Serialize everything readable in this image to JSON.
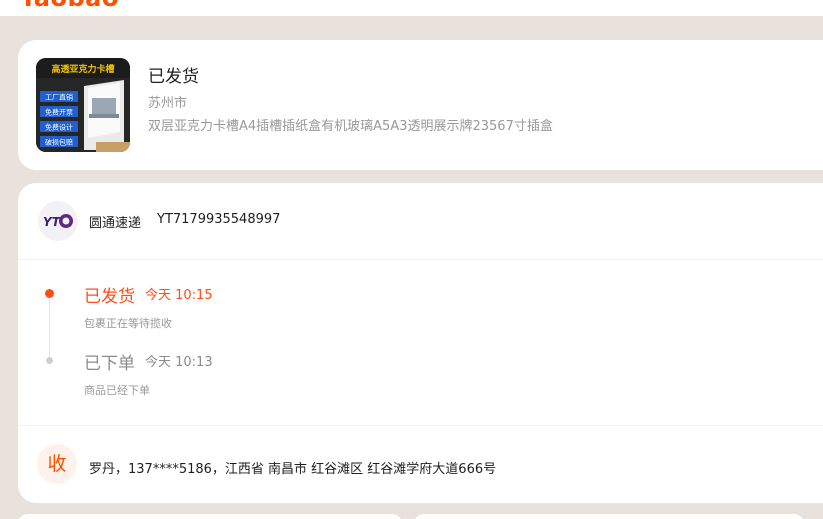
{
  "app": {
    "logo": "Taobao"
  },
  "order": {
    "status": "已发货",
    "city": "苏州市",
    "product_title": "双层亚克力卡槽A4插槽插纸盒有机玻璃A5A3透明展示牌23567寸插盒",
    "thumbnail": {
      "banner": "高透亚克力卡槽",
      "tags": [
        "工厂直销",
        "免费开票",
        "免费设计",
        "破损包赔"
      ]
    }
  },
  "logistics": {
    "courier_logo": "YTO",
    "courier_name": "圆通速递",
    "tracking_number": "YT7179935548997",
    "events": [
      {
        "status": "已发货",
        "time": "今天 10:15",
        "desc": "包裹正在等待揽收"
      },
      {
        "status": "已下单",
        "time": "今天 10:13",
        "desc": "商品已经下单"
      }
    ],
    "receive_badge": "收",
    "address": "罗丹，137****5186，江西省 南昌市 红谷滩区 红谷滩学府大道666号"
  },
  "colors": {
    "accent": "#ff5000",
    "active": "#ff4d1a",
    "muted": "#999999",
    "background": "#e8e1dc"
  },
  "icons": {
    "timeline_active": "dot-active-icon",
    "timeline_inactive": "dot-inactive-icon"
  }
}
